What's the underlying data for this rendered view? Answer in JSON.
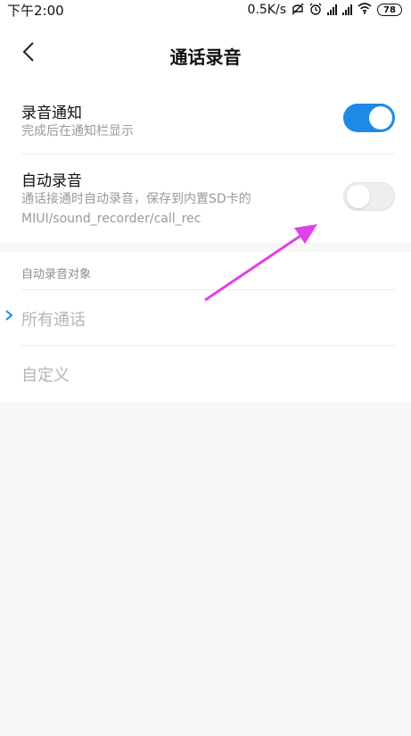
{
  "status_bar": {
    "time": "下午2:00",
    "net_speed": "0.5K/s",
    "battery": "78",
    "icons": [
      "mute-icon",
      "alarm-icon",
      "signal-hd-icon",
      "signal-icon",
      "wifi-icon",
      "battery-icon"
    ]
  },
  "header": {
    "title": "通话录音",
    "back_icon": "chevron-left-icon"
  },
  "settings": {
    "record_notice": {
      "label": "录音通知",
      "description": "完成后在通知栏显示",
      "enabled": true
    },
    "auto_record": {
      "label": "自动录音",
      "description": "通话接通时自动录音，保存到内置SD卡的MIUI/sound_recorder/call_rec",
      "enabled": false
    }
  },
  "auto_record_target": {
    "header": "自动录音对象",
    "options": [
      {
        "label": "所有通话",
        "selected": true
      },
      {
        "label": "自定义",
        "selected": false
      }
    ]
  },
  "colors": {
    "accent": "#1c8ae6",
    "annotation_arrow": "#e040e8"
  }
}
